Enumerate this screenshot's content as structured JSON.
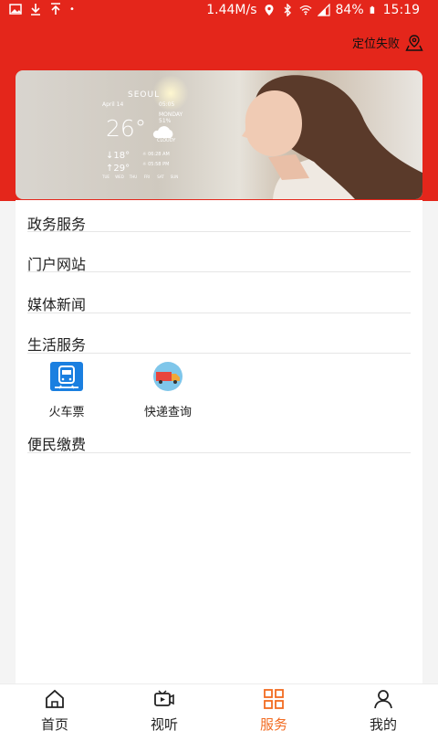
{
  "status_bar": {
    "speed": "1.44M/s",
    "battery": "84%",
    "time": "15:19"
  },
  "header": {
    "location_label": "定位失败",
    "location_icon": "location-pin-icon"
  },
  "banner": {
    "city": "SEOUL",
    "date": "April 14",
    "date_right": "05:05",
    "temperature": "26°",
    "day": "MONDAY",
    "humidity": "51%",
    "condition": "CLOUDY",
    "low": "18°",
    "high": "29°",
    "sunrise": "06:28 AM",
    "sunset": "05:58 PM",
    "forecast_days": [
      "TUE",
      "WED",
      "THU",
      "FRI",
      "SAT",
      "SUN"
    ]
  },
  "sections": [
    {
      "label": "政务服务"
    },
    {
      "label": "门户网站"
    },
    {
      "label": "媒体新闻"
    },
    {
      "label": "生活服务"
    },
    {
      "label": "便民缴费"
    }
  ],
  "life_services": [
    {
      "label": "火车票",
      "icon": "train-icon"
    },
    {
      "label": "快递查询",
      "icon": "delivery-truck-icon"
    }
  ],
  "tabs": [
    {
      "label": "首页",
      "icon": "home-icon",
      "active": false
    },
    {
      "label": "视听",
      "icon": "video-icon",
      "active": false
    },
    {
      "label": "服务",
      "icon": "grid-icon",
      "active": true
    },
    {
      "label": "我的",
      "icon": "user-icon",
      "active": false
    }
  ],
  "colors": {
    "brand_red": "#e4261b",
    "active_orange": "#f26b21"
  }
}
